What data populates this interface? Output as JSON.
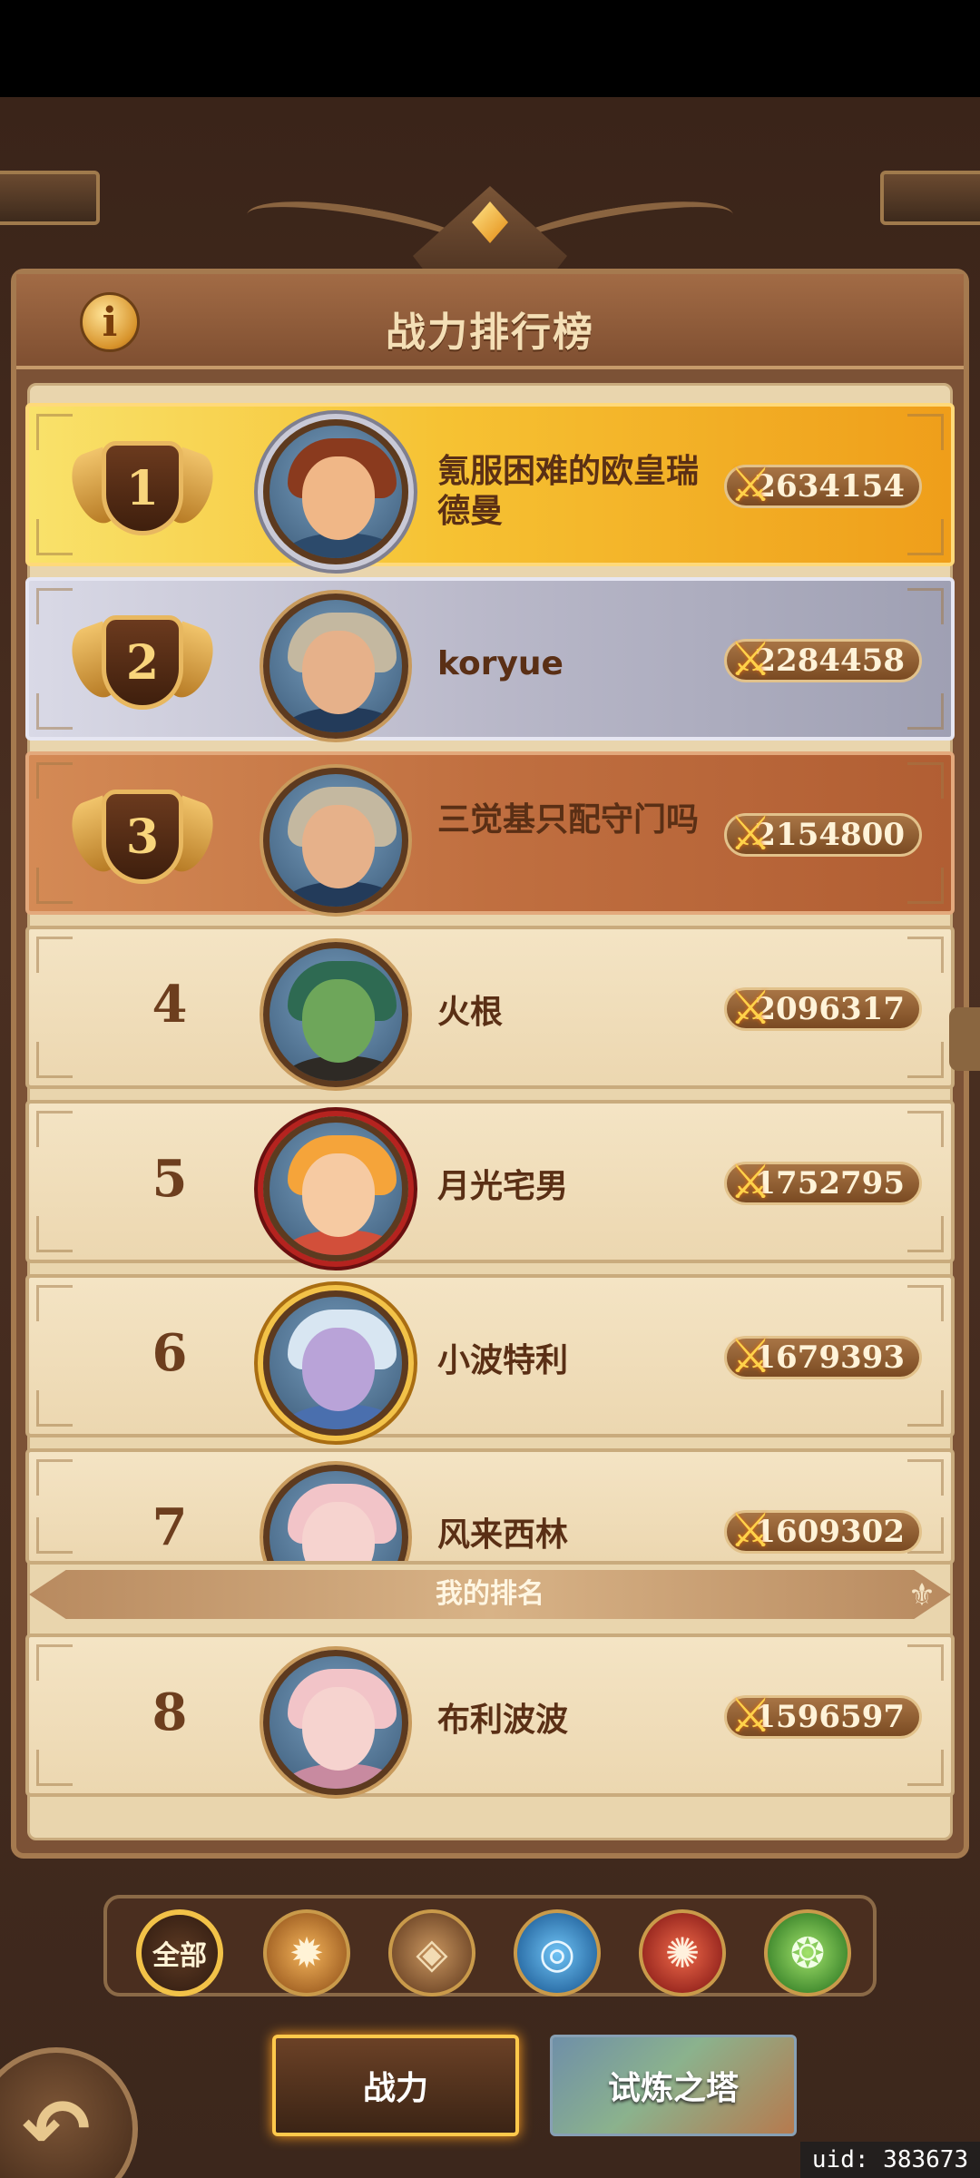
{
  "header": {
    "title": "战力排行榜",
    "info_icon": "info-icon",
    "info_label": "i"
  },
  "my_rank_label": "我的排名",
  "rankings": [
    {
      "rank": "1",
      "name": "氪服困难的欧皇瑞德曼",
      "power": "2634154",
      "tier": "gold"
    },
    {
      "rank": "2",
      "name": "koryue",
      "power": "2284458",
      "tier": "silver"
    },
    {
      "rank": "3",
      "name": "三觉基只配守门吗",
      "power": "2154800",
      "tier": "bronze"
    },
    {
      "rank": "4",
      "name": "火根",
      "power": "2096317",
      "tier": "normal"
    },
    {
      "rank": "5",
      "name": "月光宅男",
      "power": "1752795",
      "tier": "normal"
    },
    {
      "rank": "6",
      "name": "小波特利",
      "power": "1679393",
      "tier": "normal"
    },
    {
      "rank": "7",
      "name": "风来西林",
      "power": "1609302",
      "tier": "normal"
    }
  ],
  "my_rank": {
    "rank": "8",
    "name": "布利波波",
    "power": "1596597"
  },
  "filters": [
    {
      "label": "全部",
      "icon": "all",
      "selected": true
    },
    {
      "label": "",
      "icon": "faction-light-icon",
      "color": "#d98a2e"
    },
    {
      "label": "",
      "icon": "faction-earth-icon",
      "color": "#8a5a2c"
    },
    {
      "label": "",
      "icon": "faction-water-icon",
      "color": "#2c7fc9"
    },
    {
      "label": "",
      "icon": "faction-fire-icon",
      "color": "#b8261f"
    },
    {
      "label": "",
      "icon": "faction-wind-icon",
      "color": "#3f9a2e"
    }
  ],
  "tabs": [
    {
      "label": "战力",
      "active": true
    },
    {
      "label": "试炼之塔",
      "active": false
    }
  ],
  "uid": "uid: 383673",
  "colors": {
    "gold": "#f6c233",
    "silver": "#b9b8c9",
    "bronze": "#c06f40",
    "paper": "#e9d5ad"
  }
}
